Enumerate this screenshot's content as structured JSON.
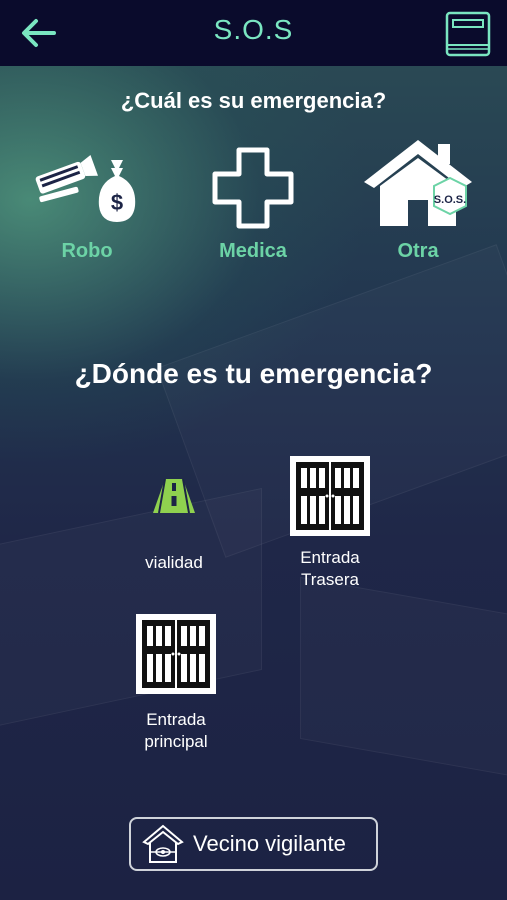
{
  "header": {
    "title": "S.O.S",
    "back_icon": "arrow-left-icon",
    "manual_icon": "book-icon"
  },
  "emergency_question": "¿Cuál es su emergencia?",
  "emergency_types": [
    {
      "label": "Robo",
      "icon": "robbery-icon"
    },
    {
      "label": "Medica",
      "icon": "medical-cross-icon"
    },
    {
      "label": "Otra",
      "icon": "house-sos-icon",
      "badge": "S.O.S."
    }
  ],
  "location_question": "¿Dónde es tu emergencia?",
  "locations": [
    {
      "label": "vialidad",
      "icon": "road-icon"
    },
    {
      "label": "Entrada\nTrasera",
      "icon": "door-icon"
    },
    {
      "label": "Entrada\nprincipal",
      "icon": "door-icon"
    }
  ],
  "footer_button": {
    "label": "Vecino vigilante",
    "icon": "house-eye-icon"
  },
  "colors": {
    "accent": "#7ae6c1",
    "label_green": "#6cd3a6",
    "topbar": "#0a0b2c",
    "road": "#8fd14f"
  }
}
